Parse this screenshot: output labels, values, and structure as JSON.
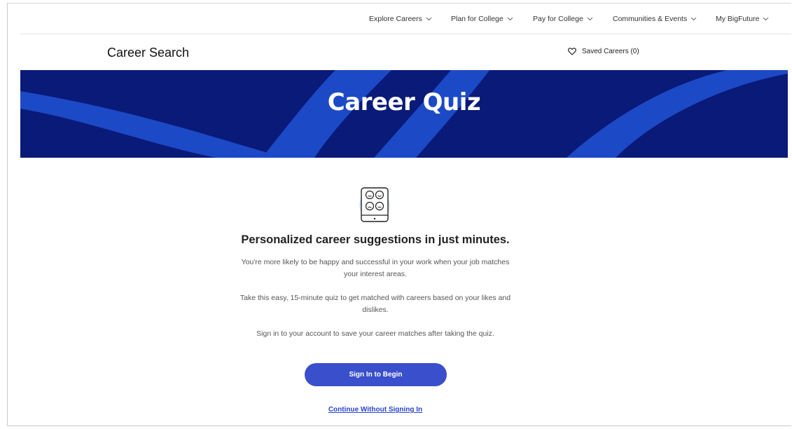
{
  "nav": {
    "items": [
      {
        "label": "Explore Careers"
      },
      {
        "label": "Plan for College"
      },
      {
        "label": "Pay for College"
      },
      {
        "label": "Communities & Events"
      },
      {
        "label": "My BigFuture"
      }
    ]
  },
  "header": {
    "title": "Career Search",
    "saved_label": "Saved Careers (0)"
  },
  "banner": {
    "title": "Career Quiz"
  },
  "main": {
    "headline": "Personalized career suggestions in just minutes.",
    "paragraphs": [
      "You're more likely to be happy and successful in your work when your job matches your interest areas.",
      "Take this easy, 15-minute quiz to get matched with careers based on your likes and dislikes.",
      "Sign in to your account to save your career matches after taking the quiz."
    ],
    "primary_button": "Sign In to Begin",
    "secondary_link": "Continue Without Signing In"
  },
  "icons": {
    "quiz": "tablet-faces-icon",
    "heart": "heart-outline-icon",
    "chevron": "chevron-down-icon"
  },
  "colors": {
    "banner_bg": "#0a1a78",
    "banner_stripe": "#1c49c6",
    "primary": "#3a4fcb",
    "link": "#2b45c9"
  }
}
